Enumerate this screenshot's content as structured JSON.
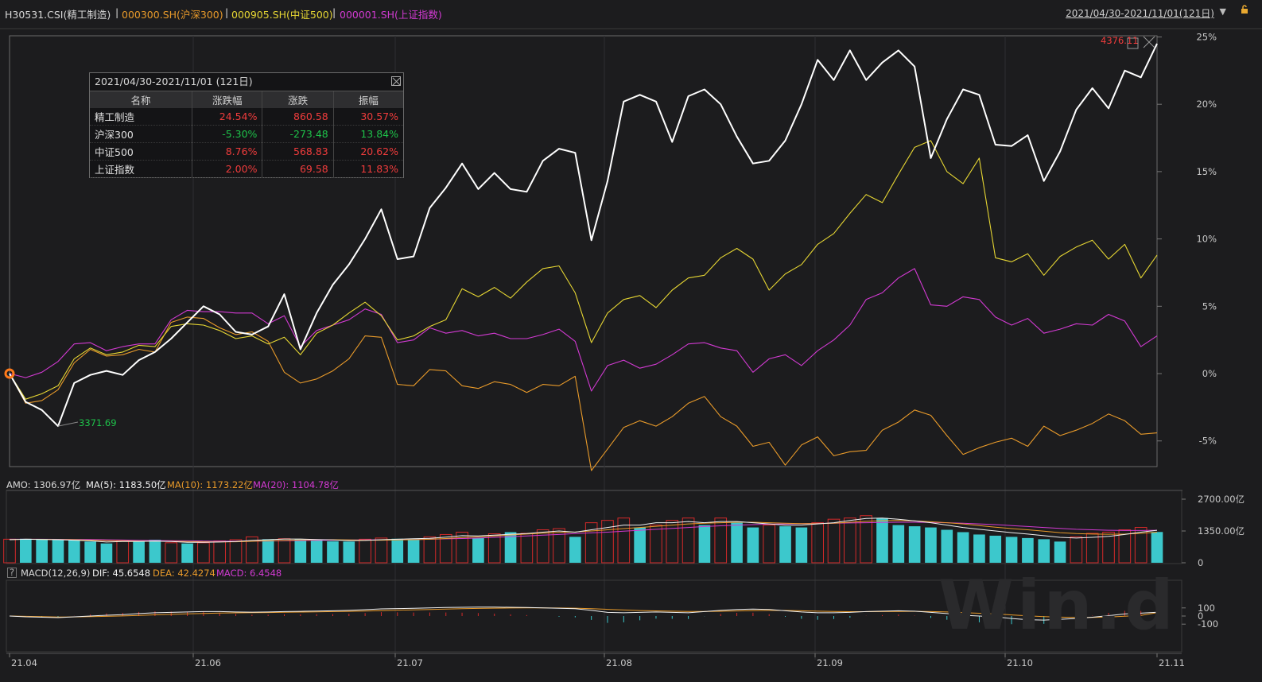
{
  "header": {
    "items": [
      {
        "text": "H30531.CSI(精工制造)",
        "color": "#d8d8d8"
      },
      {
        "text": "000300.SH(沪深300)",
        "color": "#e89a2a"
      },
      {
        "text": "000905.SH(中证500)",
        "color": "#e6d633"
      },
      {
        "text": "000001.SH(上证指数)",
        "color": "#d23ad2"
      }
    ],
    "separator": "|",
    "range": "2021/04/30-2021/11/01(121日)"
  },
  "stats_panel": {
    "title": "2021/04/30-2021/11/01 (121日)",
    "columns": [
      "名称",
      "涨跌幅",
      "涨跌",
      "振幅"
    ],
    "rows": [
      {
        "name": "精工制造",
        "pct": "24.54%",
        "chg": "860.58",
        "amp": "30.57%",
        "sign": "pos"
      },
      {
        "name": "沪深300",
        "pct": "-5.30%",
        "chg": "-273.48",
        "amp": "13.84%",
        "sign": "neg"
      },
      {
        "name": "中证500",
        "pct": "8.76%",
        "chg": "568.83",
        "amp": "20.62%",
        "sign": "pos"
      },
      {
        "name": "上证指数",
        "pct": "2.00%",
        "chg": "69.58",
        "amp": "11.83%",
        "sign": "pos"
      }
    ]
  },
  "annotations": {
    "min_label": "3371.69",
    "max_label": "4376.11"
  },
  "amo_legend": {
    "amo": "AMO: 1306.97亿",
    "ma5": "MA(5): 1183.50亿",
    "ma10": "MA(10): 1173.22亿",
    "ma20": "MA(20): 1104.78亿"
  },
  "macd_legend": {
    "help": "?",
    "title": "MACD(12,26,9)",
    "dif": "DIF: 45.6548",
    "dea": "DEA: 42.4274",
    "macd": "MACD: 6.4548"
  },
  "x_labels": [
    "21.04",
    "21.06",
    "21.07",
    "21.08",
    "21.09",
    "21.10",
    "21.11"
  ],
  "watermark": "Win.d",
  "colors": {
    "index": "#ffffff",
    "hs300": "#e89a2a",
    "zz500": "#e6d633",
    "sh": "#d23ad2",
    "up_bar": "#d42a2a",
    "down_bar": "#3cc8cc"
  },
  "chart_data": [
    {
      "type": "line",
      "title": "",
      "ylabel": "",
      "y_ticks": [
        "25%",
        "20%",
        "15%",
        "10%",
        "5%",
        "0%",
        "-5%"
      ],
      "ylim": [
        -7.2,
        25.5
      ],
      "x_start": "2021/04/30",
      "x_end": "2021/11/01",
      "series": [
        {
          "name": "精工制造",
          "values": [
            0,
            -2.1,
            -2.7,
            -3.9,
            -0.7,
            -0.1,
            0.2,
            -0.1,
            1.0,
            1.6,
            2.6,
            3.8,
            5.0,
            4.4,
            3.1,
            2.9,
            3.5,
            5.9,
            1.8,
            4.5,
            6.6,
            8.1,
            10.0,
            12.2,
            8.5,
            8.7,
            12.3,
            13.8,
            15.6,
            13.7,
            14.9,
            13.7,
            13.5,
            15.8,
            16.7,
            16.4,
            9.9,
            14.3,
            20.2,
            20.7,
            20.2,
            17.2,
            20.6,
            21.1,
            20.0,
            17.6,
            15.6,
            15.8,
            17.3,
            20.0,
            23.3,
            21.8,
            24.0,
            21.8,
            23.1,
            24.0,
            22.8,
            16.0,
            18.9,
            21.1,
            20.7,
            17.0,
            16.9,
            17.7,
            14.3,
            16.5,
            19.6,
            21.2,
            19.7,
            22.5,
            22.0,
            24.5
          ]
        },
        {
          "name": "沪深300",
          "values": [
            0,
            -2.2,
            -2.0,
            -1.2,
            0.8,
            1.8,
            1.3,
            1.4,
            1.8,
            1.6,
            3.8,
            4.2,
            4.1,
            3.4,
            2.9,
            3.1,
            2.4,
            0.1,
            -0.7,
            -0.4,
            0.2,
            1.1,
            2.8,
            2.7,
            -0.8,
            -0.9,
            0.3,
            0.2,
            -0.9,
            -1.1,
            -0.6,
            -0.8,
            -1.4,
            -0.8,
            -0.9,
            -0.2,
            -7.2,
            -5.6,
            -4.0,
            -3.5,
            -3.9,
            -3.2,
            -2.2,
            -1.7,
            -3.2,
            -3.9,
            -5.4,
            -5.1,
            -6.8,
            -5.3,
            -4.7,
            -6.1,
            -5.8,
            -5.7,
            -4.2,
            -3.6,
            -2.7,
            -3.1,
            -4.6,
            -6.0,
            -5.5,
            -5.1,
            -4.8,
            -5.4,
            -3.9,
            -4.6,
            -4.2,
            -3.7,
            -3.0,
            -3.5,
            -4.5,
            -4.4
          ]
        },
        {
          "name": "中证500",
          "values": [
            0,
            -1.9,
            -1.5,
            -0.9,
            1.1,
            1.9,
            1.4,
            1.6,
            2.1,
            2.0,
            3.5,
            3.7,
            3.6,
            3.2,
            2.6,
            2.8,
            2.2,
            2.7,
            1.4,
            3.0,
            3.6,
            4.5,
            5.3,
            4.3,
            2.5,
            2.8,
            3.5,
            4.0,
            6.3,
            5.7,
            6.4,
            5.6,
            6.8,
            7.8,
            8.0,
            6.0,
            2.3,
            4.5,
            5.5,
            5.8,
            4.9,
            6.2,
            7.1,
            7.3,
            8.6,
            9.3,
            8.5,
            6.2,
            7.4,
            8.1,
            9.6,
            10.4,
            11.9,
            13.3,
            12.7,
            14.8,
            16.8,
            17.3,
            15.0,
            14.1,
            16.0,
            8.6,
            8.3,
            8.9,
            7.3,
            8.7,
            9.4,
            9.9,
            8.5,
            9.6,
            7.1,
            8.8
          ]
        },
        {
          "name": "上证指数",
          "values": [
            0,
            -0.3,
            0.1,
            0.9,
            2.2,
            2.3,
            1.7,
            2.0,
            2.2,
            2.2,
            4.0,
            4.7,
            4.6,
            4.6,
            4.5,
            4.5,
            3.7,
            4.3,
            2.0,
            3.2,
            3.6,
            4.0,
            4.8,
            4.4,
            2.3,
            2.5,
            3.4,
            3.0,
            3.2,
            2.8,
            3.0,
            2.6,
            2.6,
            2.9,
            3.3,
            2.4,
            -1.3,
            0.6,
            1.0,
            0.4,
            0.7,
            1.4,
            2.2,
            2.3,
            1.9,
            1.7,
            0.1,
            1.1,
            1.4,
            0.6,
            1.7,
            2.5,
            3.6,
            5.5,
            6.0,
            7.1,
            7.8,
            5.1,
            5.0,
            5.7,
            5.5,
            4.2,
            3.6,
            4.1,
            3.0,
            3.3,
            3.7,
            3.6,
            4.4,
            3.9,
            2.0,
            2.8
          ]
        }
      ]
    },
    {
      "type": "bar",
      "title": "AMO",
      "ylabel": "",
      "y_ticks": [
        "2700.00亿",
        "1350.00亿",
        "0"
      ],
      "ylim": [
        0,
        2700
      ],
      "values": [
        1000,
        1020,
        1000,
        980,
        960,
        900,
        820,
        960,
        900,
        980,
        850,
        820,
        850,
        930,
        980,
        1100,
        1000,
        1020,
        1010,
        950,
        910,
        900,
        1000,
        1050,
        1020,
        1000,
        1100,
        1200,
        1300,
        1050,
        1230,
        1300,
        1250,
        1400,
        1450,
        1100,
        1700,
        1800,
        1900,
        1500,
        1600,
        1800,
        1900,
        1600,
        1900,
        1700,
        1500,
        1600,
        1550,
        1500,
        1700,
        1850,
        1900,
        2000,
        1900,
        1600,
        1550,
        1500,
        1400,
        1300,
        1200,
        1150,
        1100,
        1050,
        1000,
        900,
        1100,
        1250,
        1300,
        1400,
        1500,
        1306.97
      ],
      "direction": [
        "u",
        "d",
        "d",
        "d",
        "d",
        "d",
        "d",
        "u",
        "d",
        "d",
        "u",
        "d",
        "u",
        "u",
        "u",
        "u",
        "d",
        "u",
        "d",
        "d",
        "d",
        "d",
        "u",
        "u",
        "d",
        "d",
        "u",
        "u",
        "u",
        "d",
        "u",
        "d",
        "u",
        "u",
        "u",
        "d",
        "u",
        "u",
        "u",
        "d",
        "u",
        "u",
        "u",
        "d",
        "u",
        "d",
        "d",
        "u",
        "d",
        "d",
        "u",
        "u",
        "u",
        "u",
        "d",
        "d",
        "d",
        "d",
        "d",
        "d",
        "d",
        "d",
        "d",
        "d",
        "d",
        "d",
        "u",
        "u",
        "u",
        "u",
        "u",
        "d"
      ],
      "ma5": [
        980,
        1000,
        990,
        980,
        960,
        930,
        880,
        900,
        900,
        920,
        900,
        870,
        870,
        880,
        900,
        950,
        980,
        1010,
        1010,
        990,
        970,
        940,
        950,
        980,
        1000,
        1020,
        1040,
        1090,
        1150,
        1140,
        1170,
        1210,
        1240,
        1300,
        1350,
        1300,
        1400,
        1500,
        1600,
        1600,
        1700,
        1700,
        1750,
        1700,
        1750,
        1750,
        1700,
        1650,
        1600,
        1600,
        1650,
        1700,
        1800,
        1880,
        1900,
        1850,
        1780,
        1700,
        1600,
        1500,
        1420,
        1350,
        1280,
        1220,
        1150,
        1080,
        1050,
        1080,
        1120,
        1200,
        1300,
        1380
      ],
      "ma10": [
        990,
        1000,
        995,
        990,
        980,
        960,
        940,
        930,
        920,
        920,
        910,
        900,
        890,
        885,
        890,
        910,
        930,
        950,
        970,
        980,
        980,
        970,
        960,
        960,
        970,
        980,
        1000,
        1030,
        1070,
        1100,
        1140,
        1180,
        1220,
        1260,
        1290,
        1310,
        1350,
        1400,
        1450,
        1500,
        1550,
        1600,
        1650,
        1680,
        1700,
        1720,
        1720,
        1700,
        1680,
        1660,
        1660,
        1680,
        1720,
        1760,
        1790,
        1800,
        1780,
        1740,
        1700,
        1650,
        1580,
        1510,
        1450,
        1400,
        1340,
        1280,
        1240,
        1220,
        1210,
        1220,
        1250,
        1300
      ],
      "ma20": [
        1000,
        1000,
        1000,
        995,
        990,
        985,
        975,
        965,
        955,
        945,
        935,
        930,
        920,
        915,
        915,
        920,
        925,
        935,
        945,
        955,
        960,
        965,
        970,
        975,
        980,
        990,
        1000,
        1015,
        1030,
        1050,
        1080,
        1110,
        1140,
        1170,
        1200,
        1240,
        1270,
        1300,
        1340,
        1380,
        1420,
        1460,
        1500,
        1540,
        1570,
        1600,
        1620,
        1640,
        1650,
        1660,
        1670,
        1680,
        1690,
        1700,
        1710,
        1720,
        1720,
        1710,
        1700,
        1680,
        1650,
        1620,
        1580,
        1540,
        1500,
        1460,
        1420,
        1400,
        1380,
        1370,
        1370,
        1380
      ]
    },
    {
      "type": "line",
      "title": "MACD(12,26,9)",
      "ylabel": "",
      "y_ticks": [
        "100",
        "0",
        "-100"
      ],
      "ylim": [
        -120,
        120
      ],
      "dif": [
        0,
        -10,
        -15,
        -20,
        -10,
        0,
        10,
        18,
        30,
        40,
        45,
        50,
        55,
        55,
        50,
        48,
        50,
        55,
        58,
        62,
        65,
        70,
        78,
        88,
        92,
        95,
        100,
        105,
        108,
        110,
        110,
        108,
        105,
        100,
        95,
        90,
        70,
        45,
        40,
        45,
        50,
        45,
        40,
        55,
        70,
        80,
        85,
        80,
        65,
        50,
        40,
        40,
        45,
        55,
        60,
        65,
        60,
        45,
        30,
        10,
        0,
        -10,
        -30,
        -45,
        -50,
        -40,
        -30,
        -15,
        5,
        25,
        35,
        45.6548
      ],
      "dea": [
        0,
        -4,
        -8,
        -12,
        -11,
        -8,
        -4,
        1,
        8,
        15,
        21,
        27,
        32,
        37,
        39,
        41,
        43,
        46,
        49,
        52,
        55,
        58,
        62,
        67,
        72,
        76,
        81,
        86,
        90,
        94,
        97,
        99,
        100,
        100,
        99,
        97,
        91,
        82,
        74,
        68,
        64,
        60,
        56,
        56,
        59,
        63,
        67,
        70,
        69,
        65,
        60,
        56,
        54,
        54,
        55,
        57,
        58,
        55,
        50,
        42,
        34,
        25,
        14,
        2,
        -8,
        -14,
        -17,
        -17,
        -12,
        -3,
        8,
        42.4274
      ],
      "macd": [
        0,
        -12,
        -14,
        -16,
        2,
        16,
        28,
        34,
        44,
        50,
        48,
        46,
        46,
        36,
        22,
        14,
        14,
        18,
        18,
        20,
        20,
        24,
        32,
        42,
        40,
        38,
        38,
        38,
        36,
        32,
        26,
        18,
        10,
        0,
        -8,
        -14,
        -42,
        -74,
        -68,
        -46,
        -28,
        -30,
        -32,
        -2,
        22,
        34,
        36,
        20,
        -8,
        -30,
        -40,
        -32,
        -18,
        2,
        10,
        16,
        4,
        -20,
        -40,
        -64,
        -68,
        -70,
        -88,
        -94,
        -84,
        -52,
        -26,
        4,
        34,
        56,
        54,
        6.4548
      ]
    }
  ]
}
